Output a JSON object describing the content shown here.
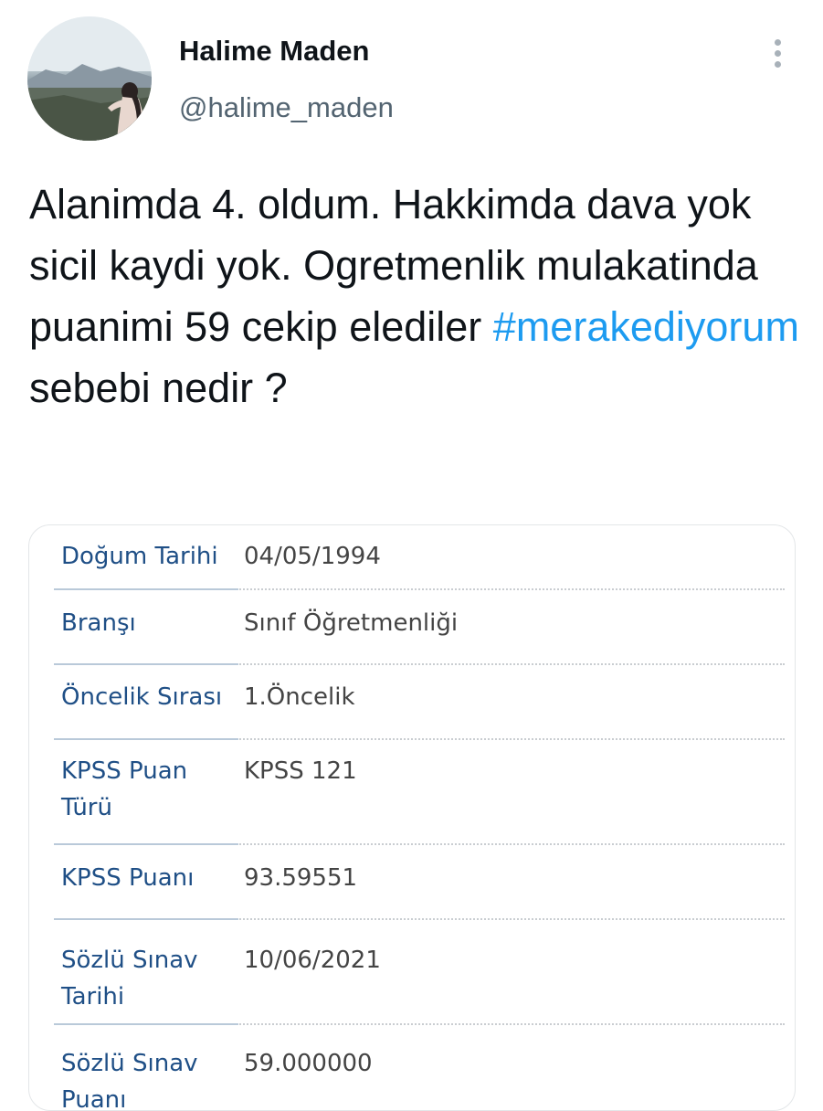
{
  "author": {
    "display_name": "Halime Maden",
    "handle": "@halime_maden",
    "avatar_icon": "profile-photo"
  },
  "more_icon": "more-vertical-icon",
  "tweet": {
    "text_before": "Alanimda 4. oldum. Hakkimda dava yok sicil kaydi yok. Ogretmenlik mulakatinda puanimi 59 cekip elediler ",
    "hashtag": "#merakediyorum",
    "text_after": " sebebi nedir ?",
    "hashtag_color": "#1d9bf0"
  },
  "media": {
    "rows": [
      {
        "label": "Doğum Tarihi",
        "value": "04/05/1994"
      },
      {
        "label": "Branşı",
        "value": "Sınıf Öğretmenliği"
      },
      {
        "label": "Öncelik Sırası",
        "value": "1.Öncelik"
      },
      {
        "label": "KPSS Puan Türü",
        "value": "KPSS 121"
      },
      {
        "label": "KPSS Puanı",
        "value": "93.59551"
      },
      {
        "label": "Sözlü Sınav Tarihi",
        "value": "10/06/2021"
      },
      {
        "label": "Sözlü Sınav Puanı",
        "value": "59.000000"
      }
    ],
    "label_color": "#1f4f86",
    "value_color": "#444444"
  }
}
